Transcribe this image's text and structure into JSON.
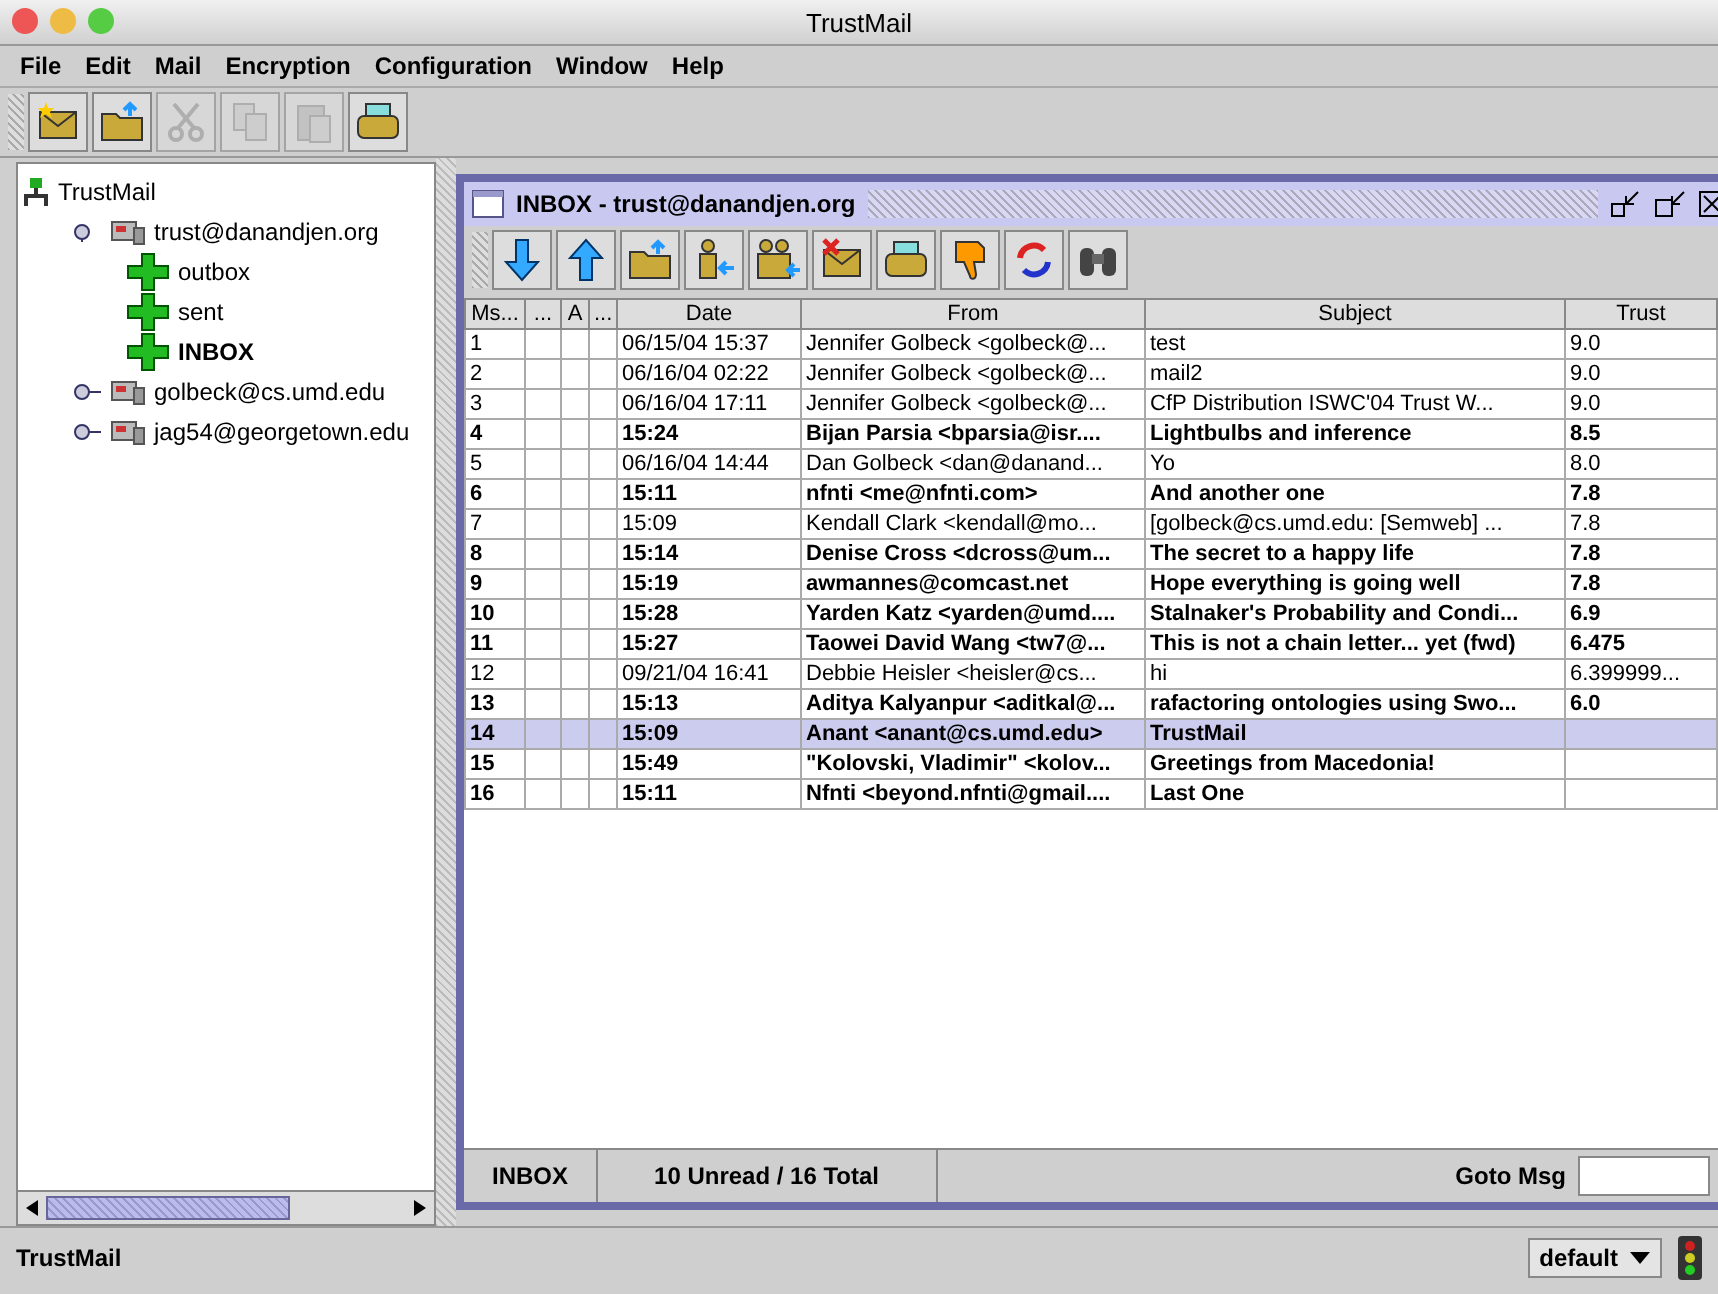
{
  "window": {
    "title": "TrustMail"
  },
  "menu": [
    "File",
    "Edit",
    "Mail",
    "Encryption",
    "Configuration",
    "Window",
    "Help"
  ],
  "toolbar": [
    {
      "kind": "new-mail",
      "disabled": false
    },
    {
      "kind": "folder-up",
      "disabled": false
    },
    {
      "kind": "cut",
      "disabled": true
    },
    {
      "kind": "copy",
      "disabled": true
    },
    {
      "kind": "paste",
      "disabled": true
    },
    {
      "kind": "print",
      "disabled": false
    }
  ],
  "tree": {
    "label": "TrustMail",
    "children": [
      {
        "label": "trust@danandjen.org",
        "expanded": true,
        "children": [
          {
            "label": "outbox",
            "selected": false
          },
          {
            "label": "sent",
            "selected": false
          },
          {
            "label": "INBOX",
            "selected": true
          }
        ]
      },
      {
        "label": "golbeck@cs.umd.edu",
        "expanded": false
      },
      {
        "label": "jag54@georgetown.edu",
        "expanded": false
      }
    ]
  },
  "inbox": {
    "title": "INBOX - trust@danandjen.org",
    "toolbar": [
      {
        "kind": "down"
      },
      {
        "kind": "up"
      },
      {
        "kind": "folder-up"
      },
      {
        "kind": "person-in"
      },
      {
        "kind": "people-in"
      },
      {
        "kind": "delete-mail"
      },
      {
        "kind": "print"
      },
      {
        "kind": "thumbs-down"
      },
      {
        "kind": "refresh"
      },
      {
        "kind": "find"
      }
    ],
    "columns": [
      "Ms...",
      "...",
      "A",
      "...",
      "Date",
      "From",
      "Subject",
      "Trust"
    ],
    "rows": [
      {
        "cells": [
          "1",
          "",
          "",
          "",
          "06/15/04 15:37",
          "Jennifer Golbeck <golbeck@...",
          "test",
          "9.0"
        ],
        "unread": false,
        "selected": false
      },
      {
        "cells": [
          "2",
          "",
          "",
          "",
          "06/16/04 02:22",
          "Jennifer Golbeck <golbeck@...",
          "mail2",
          "9.0"
        ],
        "unread": false,
        "selected": false
      },
      {
        "cells": [
          "3",
          "",
          "",
          "",
          "06/16/04 17:11",
          "Jennifer Golbeck <golbeck@...",
          "CfP Distribution ISWC'04 Trust W...",
          "9.0"
        ],
        "unread": false,
        "selected": false
      },
      {
        "cells": [
          "4",
          "",
          "",
          "",
          "15:24",
          "Bijan Parsia <bparsia@isr....",
          "Lightbulbs and inference",
          "8.5"
        ],
        "unread": true,
        "selected": false
      },
      {
        "cells": [
          "5",
          "",
          "",
          "",
          "06/16/04 14:44",
          "Dan Golbeck <dan@danand...",
          "Yo",
          "8.0"
        ],
        "unread": false,
        "selected": false
      },
      {
        "cells": [
          "6",
          "",
          "",
          "",
          "15:11",
          "nfnti <me@nfnti.com>",
          "And another one",
          "7.8"
        ],
        "unread": true,
        "selected": false
      },
      {
        "cells": [
          "7",
          "",
          "",
          "",
          "15:09",
          "Kendall Clark <kendall@mo...",
          "[golbeck@cs.umd.edu: [Semweb] ...",
          "7.8"
        ],
        "unread": false,
        "selected": false
      },
      {
        "cells": [
          "8",
          "",
          "",
          "",
          "15:14",
          "Denise Cross <dcross@um...",
          "The secret to a happy life",
          "7.8"
        ],
        "unread": true,
        "selected": false
      },
      {
        "cells": [
          "9",
          "",
          "",
          "",
          "15:19",
          "awmannes@comcast.net",
          "Hope everything is going well",
          "7.8"
        ],
        "unread": true,
        "selected": false
      },
      {
        "cells": [
          "10",
          "",
          "",
          "",
          "15:28",
          "Yarden Katz <yarden@umd....",
          "Stalnaker's Probability and Condi...",
          "6.9"
        ],
        "unread": true,
        "selected": false
      },
      {
        "cells": [
          "11",
          "",
          "",
          "",
          "15:27",
          "Taowei David Wang <tw7@...",
          "This is not a chain letter... yet (fwd)",
          "6.475"
        ],
        "unread": true,
        "selected": false
      },
      {
        "cells": [
          "12",
          "",
          "",
          "",
          "09/21/04 16:41",
          "Debbie Heisler <heisler@cs...",
          "hi",
          "6.399999..."
        ],
        "unread": false,
        "selected": false
      },
      {
        "cells": [
          "13",
          "",
          "",
          "",
          "15:13",
          "Aditya Kalyanpur <aditkal@...",
          "rafactoring ontologies using Swo...",
          "6.0"
        ],
        "unread": true,
        "selected": false
      },
      {
        "cells": [
          "14",
          "",
          "",
          "",
          "15:09",
          "Anant <anant@cs.umd.edu>",
          "TrustMail",
          ""
        ],
        "unread": true,
        "selected": true
      },
      {
        "cells": [
          "15",
          "",
          "",
          "",
          "15:49",
          "\"Kolovski, Vladimir\" <kolov...",
          "Greetings from Macedonia!",
          ""
        ],
        "unread": true,
        "selected": false
      },
      {
        "cells": [
          "16",
          "",
          "",
          "",
          "15:11",
          "Nfnti <beyond.nfnti@gmail....",
          "Last One",
          ""
        ],
        "unread": true,
        "selected": false
      }
    ],
    "status": {
      "folder": "INBOX",
      "counts": "10 Unread / 16 Total",
      "goto_label": "Goto Msg"
    }
  },
  "status_bar": {
    "text": "TrustMail",
    "dropdown": "default"
  }
}
